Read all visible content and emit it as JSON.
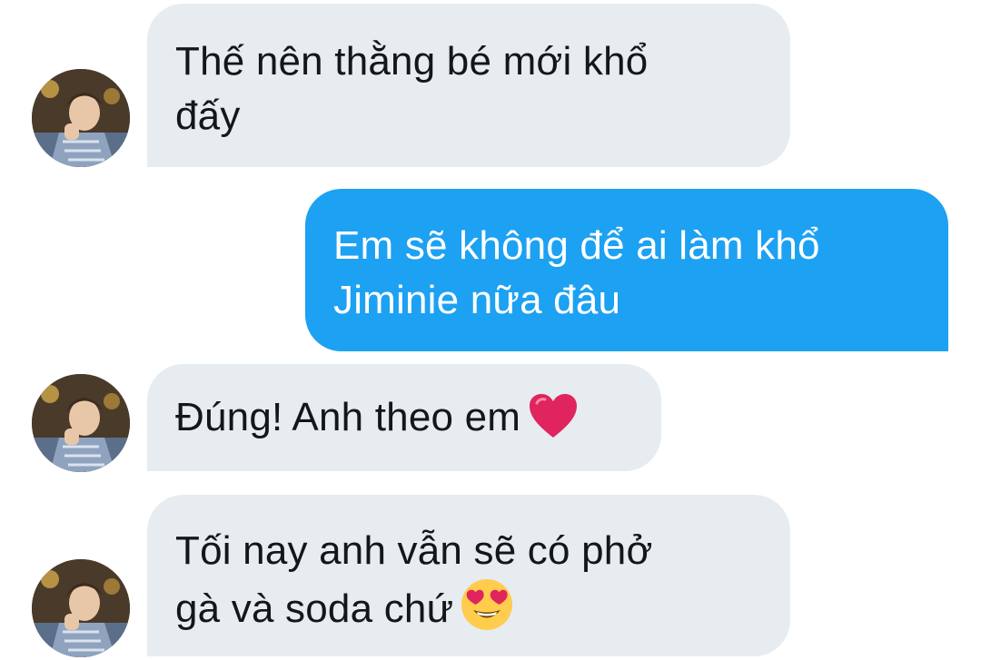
{
  "conversation": {
    "messages": [
      {
        "direction": "received",
        "lines": [
          "Thế nên thằng bé mới khổ",
          "đấy"
        ],
        "emoji": ""
      },
      {
        "direction": "sent",
        "lines": [
          "Em sẽ không để ai làm khổ",
          "Jiminie nữa đâu"
        ],
        "emoji": ""
      },
      {
        "direction": "received",
        "lines": [
          "Đúng! Anh theo em"
        ],
        "emoji": "red-heart"
      },
      {
        "direction": "received",
        "lines": [
          "Tối nay anh vẫn sẽ có phở",
          "gà và soda chứ"
        ],
        "emoji": "smiling-face-with-heart-eyes"
      }
    ]
  },
  "colors": {
    "received_bubble": "#e6ecf0",
    "received_text": "#14171a",
    "sent_bubble": "#1da1f2",
    "sent_text": "#ffffff",
    "heart": "#e0245e",
    "emoji_face": "#ffcc4d"
  }
}
